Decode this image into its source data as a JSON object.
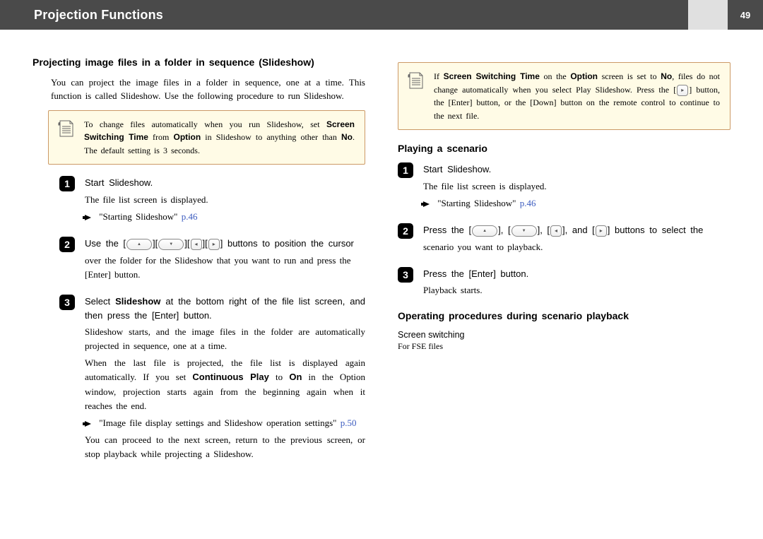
{
  "header": {
    "title": "Projection Functions",
    "page_number": "49"
  },
  "left": {
    "h": "Projecting image files in a folder in sequence (Slideshow)",
    "intro": "You can project the image files in a folder in sequence, one at a time. This function is called Slideshow. Use the following procedure to run Slideshow.",
    "tip_pre": "To change files automatically when you run Slideshow, set ",
    "tip_b1": "Screen Switching Time",
    "tip_mid1": " from ",
    "tip_b2": "Option",
    "tip_mid2": " in Slideshow to anything other than ",
    "tip_b3": "No",
    "tip_post": ". The default setting is 3 seconds.",
    "s1_main": "Start Slideshow.",
    "s1_sub": "The file list screen is displayed.",
    "s1_xref_label": "\"Starting Slideshow\"",
    "s1_xref_page": "p.46",
    "s2_pre": "Use the [",
    "s2_mid1": "][",
    "s2_mid2": "][",
    "s2_mid3": "][",
    "s2_post": "] buttons to position the cursor",
    "s2_sub": "over the folder for the Slideshow that you want to run and press the [Enter] button.",
    "s3_pre": "Select ",
    "s3_b": "Slideshow",
    "s3_post": " at the bottom right of the file list screen, and then press the [Enter] button.",
    "s3_sub1": "Slideshow starts, and the image files in the folder are automatically projected in sequence, one at a time.",
    "s3_sub2_pre": "When the last file is projected, the file list is displayed again automatically. If you set ",
    "s3_sub2_b1": "Continuous Play",
    "s3_sub2_mid": " to ",
    "s3_sub2_b2": "On",
    "s3_sub2_post": " in the Option window, projection starts again from the beginning again when it reaches the end.",
    "s3_xref_label": "\"Image file display settings and Slideshow operation settings\"",
    "s3_xref_page": "p.50",
    "s3_sub3": "You can proceed to the next screen, return to the previous screen, or stop playback while projecting a Slideshow."
  },
  "right": {
    "tip_pre": "If ",
    "tip_b1": "Screen Switching Time",
    "tip_mid1": " on the ",
    "tip_b2": "Option",
    "tip_mid2": " screen is set to ",
    "tip_b3": "No",
    "tip_mid3": ", files do not change automatically when you select Play Slideshow. Press the ",
    "tip_post": " button, the [Enter] button, or the [Down] button on the remote control to continue to the next file.",
    "h": "Playing a scenario",
    "s1_main": "Start Slideshow.",
    "s1_sub": "The file list screen is displayed.",
    "s1_xref_label": "\"Starting Slideshow\"",
    "s1_xref_page": "p.46",
    "s2_pre": "Press the [",
    "s2_mid": "], [",
    "s2_end": "], and [",
    "s2_post": "] buttons to select the",
    "s2_sub": "scenario you want to playback.",
    "s3_main": "Press the [Enter] button.",
    "s3_sub": "Playback starts.",
    "h2": "Operating procedures during scenario playback",
    "sub_h": "Screen switching",
    "sub_txt": "For FSE files"
  }
}
